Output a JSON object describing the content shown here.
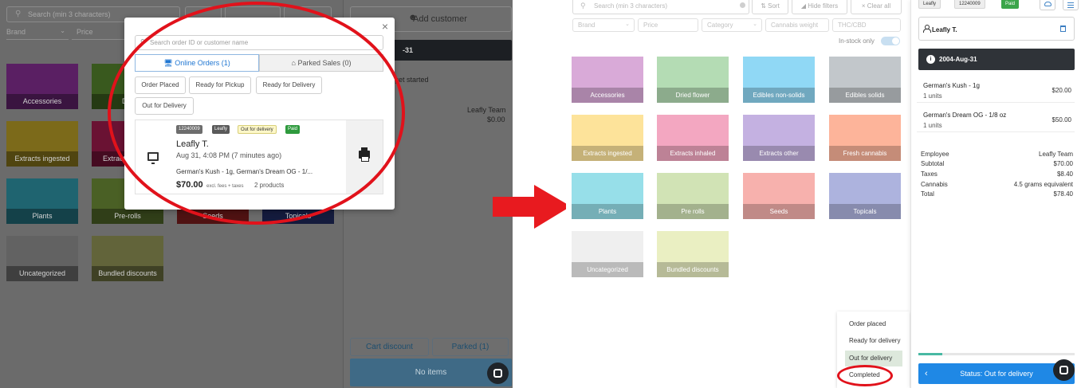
{
  "left": {
    "search_placeholder": "Search (min 3 characters)",
    "filters": [
      "Brand",
      "Price"
    ],
    "categories": [
      {
        "label": "Accessories",
        "color": "#5a1f63"
      },
      {
        "label": "Dried flower",
        "color": "#39591e"
      },
      {
        "label": "Extracts ingested",
        "color": "#7c6a1a"
      },
      {
        "label": "Extracts inhaled",
        "color": "#6a1233"
      },
      {
        "label": "Plants",
        "color": "#1f6470"
      },
      {
        "label": "Pre-rolls",
        "color": "#4a6025"
      },
      {
        "label": "Seeds",
        "color": "#7a1d1d"
      },
      {
        "label": "Topicals",
        "color": "#202a5e"
      },
      {
        "label": "Uncategorized",
        "color": "#626262"
      },
      {
        "label": "Bundled discounts",
        "color": "#62643a"
      }
    ],
    "add_customer": "Add customer",
    "date_bar": "-31",
    "get_started": "get started",
    "team_name": "Leafly Team",
    "team_total": "$0.00",
    "cart_discount": "Cart discount",
    "parked": "Parked (1)",
    "no_items": "No items"
  },
  "modal": {
    "close": "×",
    "search_placeholder": "Search order ID or customer name",
    "tabs": [
      {
        "label": "Online Orders (1)",
        "icon": "monitor-icon"
      },
      {
        "label": "Parked Sales (0)",
        "icon": "store-icon"
      }
    ],
    "status_filters": [
      "Order Placed",
      "Ready for Pickup",
      "Ready for Delivery",
      "Out for Delivery"
    ],
    "order": {
      "id": "12240009",
      "source": "Leafly",
      "status": "Out for delivery",
      "payment": "Paid",
      "customer": "Leafly T.",
      "time": "Aug 31, 4:08 PM (7 minutes ago)",
      "items": "German's Kush - 1g, German's Dream OG - 1/...",
      "amount": "$70.00",
      "fees_note": "excl. fees + taxes",
      "product_count": "2 products"
    }
  },
  "right": {
    "search_placeholder": "Search (min 3 characters)",
    "sort": "Sort",
    "hide_filters": "Hide filters",
    "clear_all": "Clear all",
    "filters": [
      "Brand",
      "Price",
      "Category",
      "Cannabis weight",
      "THC/CBD"
    ],
    "in_stock": "In-stock only",
    "categories": [
      {
        "label": "Accessories",
        "color": "#d9aad8"
      },
      {
        "label": "Dried flower",
        "color": "#b4dcb4"
      },
      {
        "label": "Edibles non-solids",
        "color": "#90d8f5"
      },
      {
        "label": "Edibles solids",
        "color": "#c2c7cb"
      },
      {
        "label": "Extracts ingested",
        "color": "#fde39a"
      },
      {
        "label": "Extracts inhaled",
        "color": "#f3a7c1"
      },
      {
        "label": "Extracts other",
        "color": "#c4b1e1"
      },
      {
        "label": "Fresh cannabis",
        "color": "#fdb49a"
      },
      {
        "label": "Plants",
        "color": "#97dfe9"
      },
      {
        "label": "Pre rolls",
        "color": "#d1e3b5"
      },
      {
        "label": "Seeds",
        "color": "#f7b1ad"
      },
      {
        "label": "Topicals",
        "color": "#adb3de"
      },
      {
        "label": "Uncategorized",
        "color": "#efefef"
      },
      {
        "label": "Bundled discounts",
        "color": "#eaefc2"
      }
    ],
    "status_menu": [
      "Order placed",
      "Ready for delivery",
      "Out for delivery",
      "Completed"
    ],
    "sidebar": {
      "source": "Leafly",
      "order_id": "12240009",
      "payment": "Paid",
      "customer": "Leafly T.",
      "date": "2004-Aug-31",
      "line_items": [
        {
          "name": "German's Kush - 1g",
          "units": "1 units",
          "price": "$20.00"
        },
        {
          "name": "German's Dream OG - 1/8 oz",
          "units": "1 units",
          "price": "$50.00"
        }
      ],
      "summary": [
        {
          "label": "Employee",
          "value": "Leafly Team"
        },
        {
          "label": "Subtotal",
          "value": "$70.00"
        },
        {
          "label": "Taxes",
          "value": "$8.40"
        },
        {
          "label": "Cannabis",
          "value": "4.5 grams equivalent"
        },
        {
          "label": "Total",
          "value": "$78.40"
        }
      ],
      "status_button": "Status: Out for delivery"
    }
  }
}
